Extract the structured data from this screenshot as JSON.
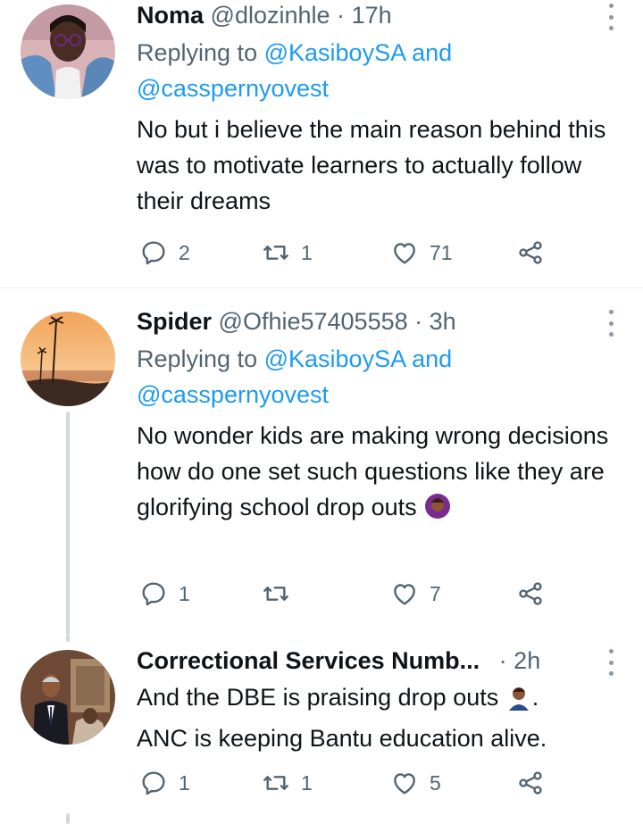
{
  "tweets": [
    {
      "name": "Noma",
      "handle": "@dlozinhle",
      "sep": "·",
      "time": "17h",
      "replying_prefix": "Replying to",
      "replying_mention1": "@KasiboySA",
      "replying_and": "and",
      "replying_mention2": "@casspernyovest",
      "text": "No but i believe the main reason behind this was to motivate learners to actually follow their dreams",
      "replies": "2",
      "retweets": "1",
      "likes": "71"
    },
    {
      "name": "Spider",
      "handle": "@Ofhie57405558",
      "sep": "·",
      "time": "3h",
      "replying_prefix": "Replying to",
      "replying_mention1": "@KasiboySA",
      "replying_and": "and",
      "replying_mention2": "@casspernyovest",
      "text": "No wonder kids are making wrong decisions how do one set such questions like they are glorifying school drop outs",
      "replies": "1",
      "retweets": "",
      "likes": "7"
    },
    {
      "name": "Correctional Services Numb...",
      "handle": "",
      "sep": "·",
      "time": "2h",
      "text_line1": "And the DBE is praising drop outs",
      "text_line1_end": ".",
      "text_line2": "ANC is keeping Bantu education alive.",
      "replies": "1",
      "retweets": "1",
      "likes": "5"
    }
  ],
  "icons": {
    "reply": "reply-icon",
    "retweet": "retweet-icon",
    "like": "heart-icon",
    "share": "share-icon",
    "more": "more-vertical-icon"
  },
  "colors": {
    "link": "#1d9bf0",
    "secondary": "#536471",
    "thread_line": "#cfd9de"
  }
}
